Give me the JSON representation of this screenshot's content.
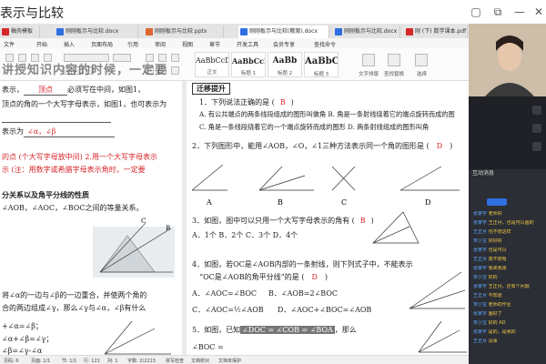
{
  "window": {
    "title": "表示与比较"
  },
  "tabs": [
    {
      "label": "稿壳模板",
      "color": "#d6262a"
    },
    {
      "label": "刚刚板示与比较.docx",
      "color": "#2f6fe0"
    },
    {
      "label": "刚刚板示与比较.pptx",
      "color": "#e0662f"
    },
    {
      "label": "刚刚板示与比较(教案).docx",
      "color": "#2f6fe0"
    },
    {
      "label": "刚刚板示与比较.docx",
      "color": "#2f6fe0"
    },
    {
      "label": "刚 (下) 数学课本.pdf",
      "color": "#d6262a"
    }
  ],
  "menu": [
    "文件",
    "开始",
    "插入",
    "页面布局",
    "引用",
    "审阅",
    "视图",
    "章节",
    "开发工具",
    "会员专享",
    "查找命令"
  ],
  "styles": [
    {
      "sample": "AaBbCcDd",
      "name": "正文"
    },
    {
      "sample": "AaBbCcDd",
      "name": "标题 1"
    },
    {
      "sample": "AaBb",
      "name": "标题 2"
    },
    {
      "sample": "AaBbC",
      "name": "标题 3"
    }
  ],
  "ribbon_labels": [
    "文字排版",
    "查找替换",
    "选择"
  ],
  "overlay": "讲授知识内容的时候，一定要",
  "left_page": {
    "l1": "表示，",
    "l1_ans": "顶点",
    "l1_tail": "必须写在中间，如图1，",
    "l2": "顶点的角的一个大写字母表示，如图1，也可表示为",
    "l3": "表示为",
    "l3_ans": "∠α，∠β",
    "l4": "的点 (个大写字母放中间)  2.用一个大写字母表示",
    "l5": "示 (注：用数字或希腊字母表示角时，一定要",
    "h1": "分关系以及角平分线的性质",
    "l6": "∠AOB，∠AOC，∠BOC之间的等量关系。",
    "l7": "将∠α的一边与∠β的一边重合，并使两个角的",
    "l8": "合的两边组成∠γ，那么∠γ与∠α，∠β有什么",
    "l9": "+∠α=∠β；",
    "l10": "∠α+∠β=∠γ；",
    "l11": "∠β=∠γ-∠α"
  },
  "right_page": {
    "section": "迁移提升",
    "q1": "1．下列说法正确的是 (",
    "q1_ans": "B",
    "q1_a": "A. 有公共端点的两条线段组成的图形叫做角  B. 角是一条射线绕着它的端点旋转而成的图",
    "q1_c": "C. 角是一条线段绕着它的一个端点旋转而成的图形    D. 两条射线组成的图形叫角",
    "q2": "2．下列图形中，能用∠AOB，∠O，∠1三种方法表示同一个角的图形是 (",
    "q2_ans": "D",
    "q3": "3．如图，图中可以只用一个大写字母表示的角有 (",
    "q3_ans": "B",
    "q3_opts": "A．1个    B．2个    C．3个    D．4个",
    "q4": "4．如图，若OC是∠AOB内部的一条射线，则下列式子中，不能表示",
    "q4b": "“OC是∠AOB的角平分线”的是 (",
    "q4_ans": "D",
    "q4_a": "A．∠AOC=∠BOC",
    "q4_b": "B．∠AOB=2∠BOC",
    "q4_c": "C．∠AOC=½∠AOB",
    "q4_d": "D．∠AOC+∠BOC=∠AOB",
    "q5": "5．如图，已知",
    "q5_hl": "∠DOC = ∠COB = ∠BOA",
    "q5_tail": "，那么",
    "q5_b": "∠BOC = ",
    "fig_labels": [
      "A",
      "B",
      "C",
      "D"
    ]
  },
  "status": [
    "页码: 6",
    "页面: 1/1",
    "节: 1/1",
    "行: 121",
    "列: 1",
    "字数: 2/2213",
    "拼写检查",
    "文档校对",
    "文档未保护"
  ],
  "side": {
    "chat_title": "互动消息",
    "messages": [
      {
        "user": "张家宇",
        "text": "老师好"
      },
      {
        "user": "张家宇",
        "text": "王正月，也是可以画的"
      },
      {
        "user": "王正月",
        "text": "也不想这样"
      },
      {
        "user": "宋小宝",
        "text": "好好好"
      },
      {
        "user": "张家宇",
        "text": "也是可以"
      },
      {
        "user": "王正月",
        "text": "真不想哈"
      },
      {
        "user": "张家宇",
        "text": "我来我来"
      },
      {
        "user": "宋小宝",
        "text": "好的"
      },
      {
        "user": "张家宇",
        "text": "王正月，还有个问题"
      },
      {
        "user": "王正月",
        "text": "不知道"
      },
      {
        "user": "宋小宝",
        "text": "老师的作业"
      },
      {
        "user": "张家宇",
        "text": "画好了"
      },
      {
        "user": "宋小宝",
        "text": "好的 AD"
      },
      {
        "user": "张家宇",
        "text": "是的，是我的"
      },
      {
        "user": "王正月",
        "text": "没事"
      }
    ]
  }
}
